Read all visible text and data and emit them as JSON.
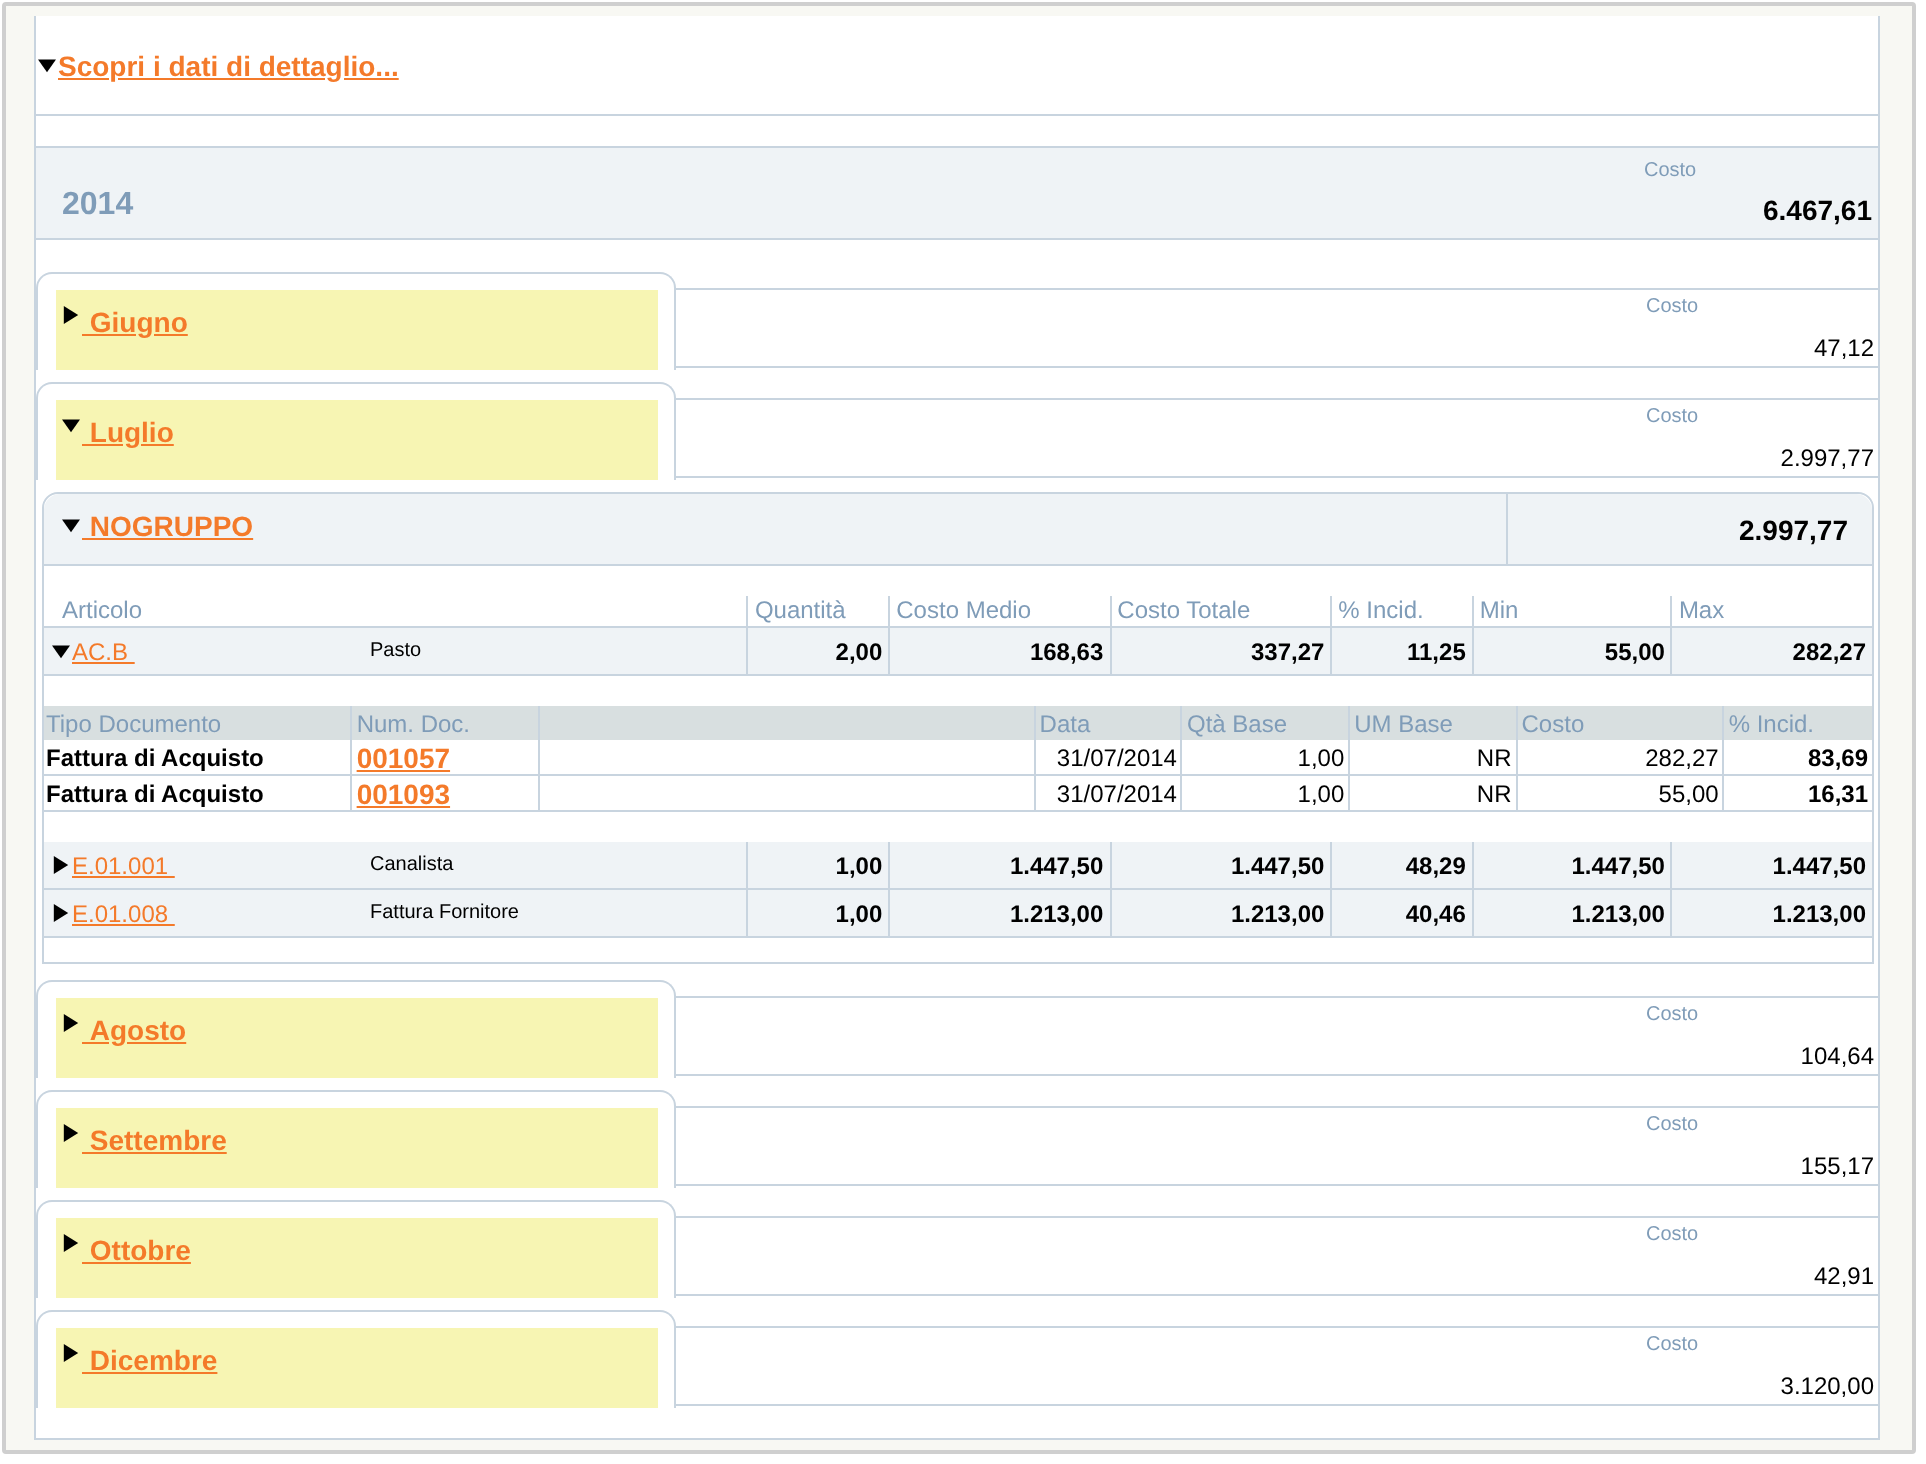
{
  "detail_link": {
    "label": "Scopri i dati di dettaglio...",
    "expanded": true
  },
  "year": {
    "label": "2014",
    "cost_label": "Costo",
    "cost": "6.467,61"
  },
  "months": [
    {
      "label": "Giugno",
      "expanded": false,
      "cost_label": "Costo",
      "cost": "47,12"
    },
    {
      "label": "Luglio",
      "expanded": true,
      "cost_label": "Costo",
      "cost": "2.997,77",
      "group": {
        "label": "NOGRUPPO",
        "expanded": true,
        "total": "2.997,77",
        "columns": [
          "Articolo",
          "Quantità",
          "Costo Medio",
          "Costo Totale",
          "% Incid.",
          "Min",
          "Max"
        ],
        "articles": [
          {
            "code": "AC.B",
            "description": "Pasto",
            "expanded": true,
            "values": [
              "2,00",
              "168,63",
              "337,27",
              "11,25",
              "55,00",
              "282,27"
            ],
            "documents": {
              "columns": [
                "Tipo Documento",
                "Num. Doc.",
                "Data",
                "Qtà Base",
                "UM Base",
                "Costo",
                "% Incid."
              ],
              "rows": [
                {
                  "type": "Fattura di Acquisto",
                  "number": "001057",
                  "date": "31/07/2014",
                  "qty": "1,00",
                  "um": "NR",
                  "cost": "282,27",
                  "incid": "83,69"
                },
                {
                  "type": "Fattura di Acquisto",
                  "number": "001093",
                  "date": "31/07/2014",
                  "qty": "1,00",
                  "um": "NR",
                  "cost": "55,00",
                  "incid": "16,31"
                }
              ]
            }
          },
          {
            "code": "E.01.001",
            "description": "Canalista",
            "expanded": false,
            "values": [
              "1,00",
              "1.447,50",
              "1.447,50",
              "48,29",
              "1.447,50",
              "1.447,50"
            ]
          },
          {
            "code": "E.01.008",
            "description": "Fattura Fornitore",
            "expanded": false,
            "values": [
              "1,00",
              "1.213,00",
              "1.213,00",
              "40,46",
              "1.213,00",
              "1.213,00"
            ]
          }
        ]
      }
    },
    {
      "label": "Agosto",
      "expanded": false,
      "cost_label": "Costo",
      "cost": "104,64"
    },
    {
      "label": "Settembre",
      "expanded": false,
      "cost_label": "Costo",
      "cost": "155,17"
    },
    {
      "label": "Ottobre",
      "expanded": false,
      "cost_label": "Costo",
      "cost": "42,91"
    },
    {
      "label": "Dicembre",
      "expanded": false,
      "cost_label": "Costo",
      "cost": "3.120,00"
    }
  ]
}
